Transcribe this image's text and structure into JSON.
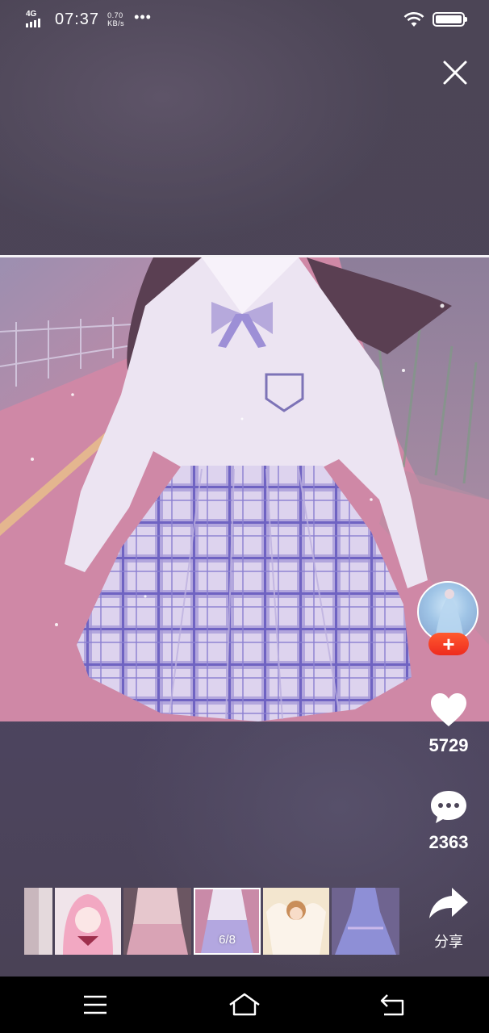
{
  "status_bar": {
    "network": "4G",
    "time": "07:37",
    "speed_value": "0.70",
    "speed_unit": "KB/s",
    "more": "•••",
    "icons": [
      "signal-icon",
      "wifi-icon",
      "battery-icon"
    ]
  },
  "viewer": {
    "close_icon": "close-icon",
    "image_alt": "girl in white shirt and lavender plaid skirt"
  },
  "actions": {
    "follow_label": "+",
    "likes": "5729",
    "comments": "2363",
    "share_label": "分享",
    "icons": [
      "heart-icon",
      "comment-icon",
      "share-icon"
    ]
  },
  "thumbnails": {
    "current_index": "6/8",
    "items": [
      {
        "name": "thumb-partial"
      },
      {
        "name": "thumb-anime-pink"
      },
      {
        "name": "thumb-pink-uniform"
      },
      {
        "name": "thumb-current"
      },
      {
        "name": "thumb-anime-angel"
      },
      {
        "name": "thumb-blue-dress"
      }
    ]
  },
  "nav": {
    "icons": [
      "menu-icon",
      "home-icon",
      "back-icon"
    ]
  },
  "colors": {
    "background": "#4a4358",
    "follow": "#f03a22",
    "nav": "#000000"
  }
}
